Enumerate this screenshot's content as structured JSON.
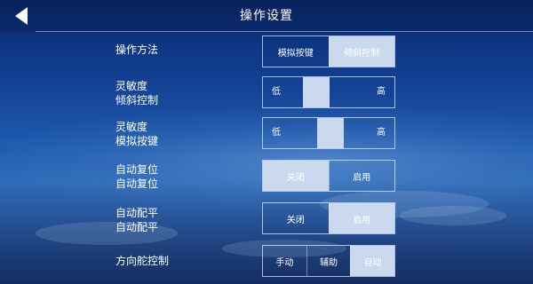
{
  "header": {
    "title": "操作设置",
    "back_icon": "back-arrow-icon"
  },
  "theme": {
    "selected_bg": "#cbd9ee",
    "border": "#dcebff",
    "sky_top": "#0a2a6e",
    "sky_mid": "#2f6cb8"
  },
  "settings": {
    "operation_method": {
      "label": "操作方法",
      "options": [
        "模拟按键",
        "倾斜控制"
      ],
      "selected": "倾斜控制"
    },
    "sensitivity_tilt": {
      "label_line1": "灵敏度",
      "label_line2": "倾斜控制",
      "low_label": "低",
      "high_label": "高",
      "level": 0.38
    },
    "sensitivity_keys": {
      "label_line1": "灵敏度",
      "label_line2": "模拟按键",
      "low_label": "低",
      "high_label": "高",
      "level": 0.52
    },
    "auto_reset": {
      "label_line1": "自动复位",
      "label_line2": "自动复位",
      "options": [
        "关闭",
        "启用"
      ],
      "selected": "关闭"
    },
    "auto_trim": {
      "label_line1": "自动配平",
      "label_line2": "自动配平",
      "options": [
        "关闭",
        "启用"
      ],
      "selected": "启用"
    },
    "rudder_control": {
      "label": "方向舵控制",
      "options": [
        "手动",
        "辅助",
        "自动"
      ],
      "selected": "自动"
    }
  }
}
